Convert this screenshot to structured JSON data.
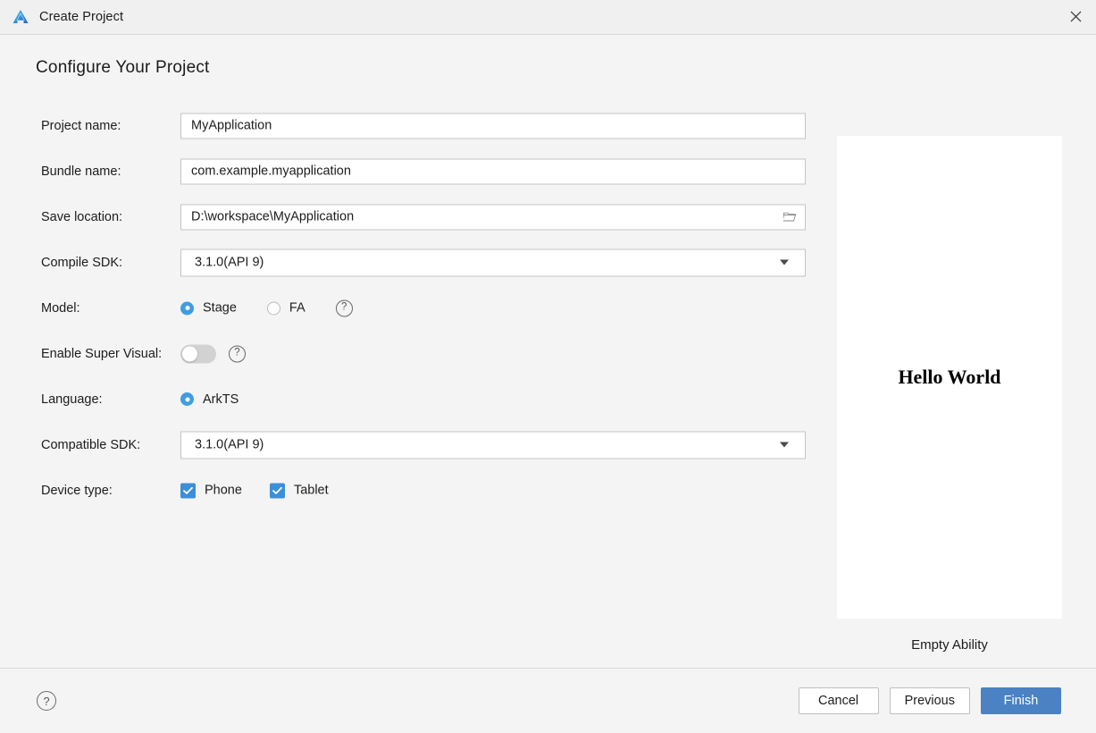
{
  "window": {
    "title": "Create Project",
    "logo_icon": "deveco-logo-icon",
    "close_icon": "close-icon"
  },
  "heading": "Configure Your Project",
  "form": {
    "project_name": {
      "label": "Project name:",
      "value": "MyApplication"
    },
    "bundle_name": {
      "label": "Bundle name:",
      "value": "com.example.myapplication"
    },
    "save_location": {
      "label": "Save location:",
      "value": "D:\\workspace\\MyApplication",
      "browse_icon": "folder-icon"
    },
    "compile_sdk": {
      "label": "Compile SDK:",
      "value": "3.1.0(API 9)",
      "caret_icon": "chevron-down-icon"
    },
    "model": {
      "label": "Model:",
      "options": [
        {
          "label": "Stage",
          "selected": true
        },
        {
          "label": "FA",
          "selected": false
        }
      ],
      "help_icon": "help-icon",
      "help_label": "?"
    },
    "enable_super_visual": {
      "label": "Enable Super Visual:",
      "enabled": false,
      "help_icon": "help-icon",
      "help_label": "?"
    },
    "language": {
      "label": "Language:",
      "options": [
        {
          "label": "ArkTS",
          "selected": true
        }
      ]
    },
    "compatible_sdk": {
      "label": "Compatible SDK:",
      "value": "3.1.0(API 9)",
      "caret_icon": "chevron-down-icon"
    },
    "device_type": {
      "label": "Device type:",
      "options": [
        {
          "label": "Phone",
          "checked": true
        },
        {
          "label": "Tablet",
          "checked": true
        }
      ]
    }
  },
  "preview": {
    "screen_text": "Hello World",
    "caption": "Empty Ability"
  },
  "footer": {
    "help_icon": "help-icon",
    "help_label": "?",
    "cancel_label": "Cancel",
    "previous_label": "Previous",
    "finish_label": "Finish"
  },
  "colors": {
    "accent_blue": "#3f9de0",
    "checkbox_blue": "#3d8ed8",
    "primary_button": "#4a82c3",
    "background": "#f4f4f4"
  }
}
